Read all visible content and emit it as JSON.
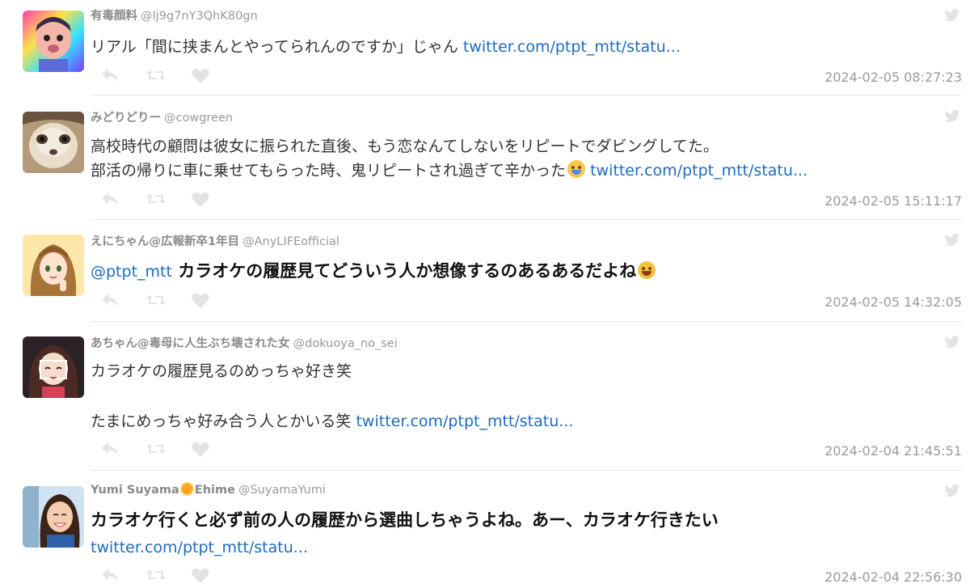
{
  "tweets": [
    {
      "name": "有毒顔料",
      "handle": "@Ij9g7nY3QhK80gn",
      "lines": [
        {
          "text": "リアル「間に挟まんとやってられんのですか」じゃん ",
          "link": "twitter.com/ptpt_mtt/statu..."
        }
      ],
      "timestamp": "2024-02-05 08:27:23",
      "style": "normal"
    },
    {
      "name": "みどりどりー",
      "handle": "@cowgreen",
      "lines": [
        {
          "text": "高校時代の顧問は彼女に振られた直後、もう恋なんてしないをリピートでダビングしてた。",
          "link": ""
        },
        {
          "text": "部活の帰りに車に乗せてもらった時、鬼リピートされ過ぎて辛かった",
          "emoji": "crying-face",
          "link": "twitter.com/ptpt_mtt/statu..."
        }
      ],
      "timestamp": "2024-02-05 15:11:17",
      "style": "normal"
    },
    {
      "name": "えにちゃん@広報新卒1年目",
      "handle": "@AnyLIFEofficial",
      "mention": "@ptpt_mtt",
      "lines": [
        {
          "text": "カラオケの履歴見てどういう人か想像するのあるあるだよね",
          "emoji": "rolling-laughing-face",
          "link": ""
        }
      ],
      "timestamp": "2024-02-05 14:32:05",
      "style": "bold"
    },
    {
      "name": "あちゃん@毒母に人生ぶち壊された女",
      "handle": "@dokuoya_no_sei",
      "lines": [
        {
          "text": "カラオケの履歴見るのめっちゃ好き笑",
          "link": ""
        },
        {
          "text": "",
          "link": ""
        },
        {
          "text": "たまにめっちゃ好み合う人とかいる笑 ",
          "link": "twitter.com/ptpt_mtt/statu..."
        }
      ],
      "timestamp": "2024-02-04 21:45:51",
      "style": "normal"
    },
    {
      "name": "Yumi Suyama",
      "name_suffix": "Ehime",
      "handle": "@SuyamaYumi",
      "lines": [
        {
          "text": "カラオケ行くと必ず前の人の履歴から選曲しちゃうよね。あー、カラオケ行きたい",
          "link": ""
        },
        {
          "text": "",
          "link": "twitter.com/ptpt_mtt/statu..."
        }
      ],
      "timestamp": "2024-02-04 22:56:30",
      "style": "bold"
    }
  ],
  "icons": {
    "reply": "reply-icon",
    "retweet": "retweet-icon",
    "like": "heart-icon",
    "platform": "twitter-bird-icon"
  },
  "colors": {
    "link": "#1c6bbd",
    "icon_gray": "#e3e3e3",
    "timestamp": "#9a9a9a"
  }
}
